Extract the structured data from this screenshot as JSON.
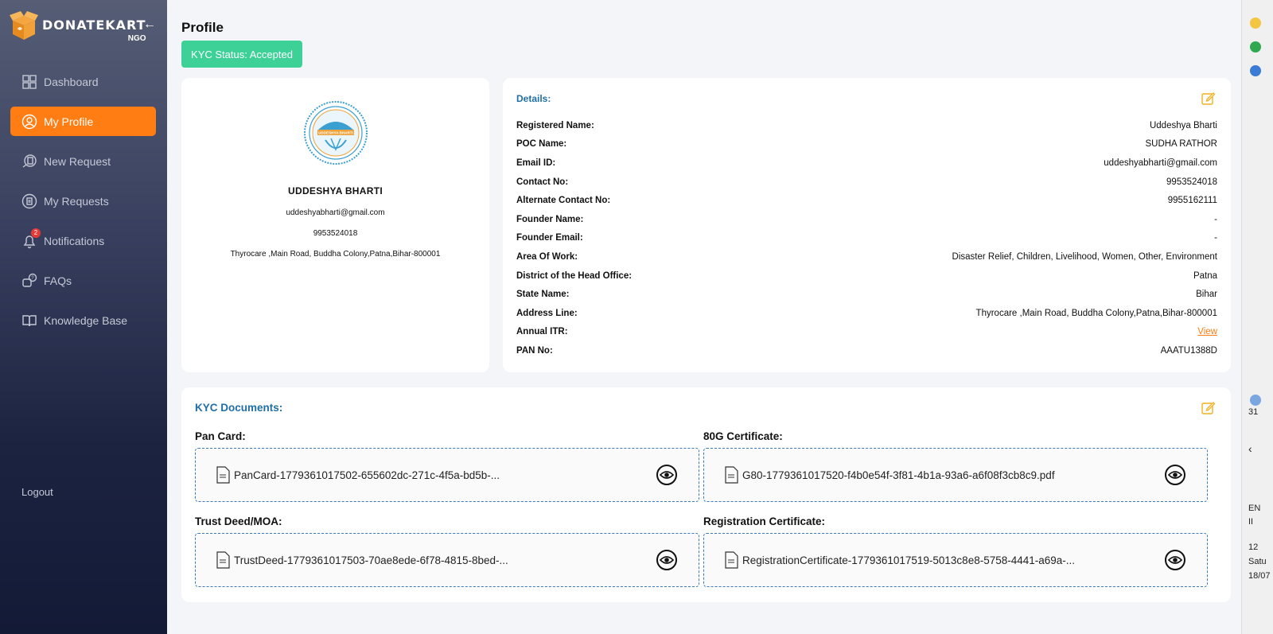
{
  "brand": {
    "name": "DONATEKART",
    "sub": "NGO"
  },
  "sidebar": {
    "items": [
      {
        "label": "Dashboard",
        "icon": "dashboard-icon",
        "active": false
      },
      {
        "label": "My Profile",
        "icon": "user-icon",
        "active": true
      },
      {
        "label": "New Request",
        "icon": "new-request-icon",
        "active": false
      },
      {
        "label": "My Requests",
        "icon": "requests-icon",
        "active": false
      },
      {
        "label": "Notifications",
        "icon": "bell-icon",
        "active": false,
        "badge": "2"
      },
      {
        "label": "FAQs",
        "icon": "faq-icon",
        "active": false
      },
      {
        "label": "Knowledge Base",
        "icon": "book-icon",
        "active": false
      }
    ],
    "logout_label": "Logout"
  },
  "page": {
    "title": "Profile",
    "kyc_status": "KYC Status: Accepted"
  },
  "profile": {
    "name": "UDDESHYA BHARTI",
    "email": "uddeshyabharti@gmail.com",
    "phone": "9953524018",
    "address": "Thyrocare ,Main Road, Buddha Colony,Patna,Bihar-800001",
    "logo_text": "UDDESHYA BHARTI"
  },
  "details": {
    "heading": "Details:",
    "rows": [
      {
        "label": "Registered Name:",
        "value": "Uddeshya Bharti"
      },
      {
        "label": "POC Name:",
        "value": "SUDHA RATHOR"
      },
      {
        "label": "Email ID:",
        "value": "uddeshyabharti@gmail.com"
      },
      {
        "label": "Contact No:",
        "value": "9953524018"
      },
      {
        "label": "Alternate Contact No:",
        "value": "9955162111"
      },
      {
        "label": "Founder Name:",
        "value": "-"
      },
      {
        "label": "Founder Email:",
        "value": "-"
      },
      {
        "label": "Area Of Work:",
        "value": "Disaster Relief, Children, Livelihood, Women, Other, Environment"
      },
      {
        "label": "District of the Head Office:",
        "value": "Patna"
      },
      {
        "label": "State Name:",
        "value": "Bihar"
      },
      {
        "label": "Address Line:",
        "value": "Thyrocare ,Main Road, Buddha Colony,Patna,Bihar-800001"
      },
      {
        "label": "Annual ITR:",
        "value": "View"
      },
      {
        "label": "PAN No:",
        "value": "AAATU1388D"
      }
    ]
  },
  "kyc": {
    "heading": "KYC Documents:",
    "docs": [
      {
        "label": "Pan Card:",
        "file": "PanCard-1779361017502-655602dc-271c-4f5a-bd5b-..."
      },
      {
        "label": "80G Certificate:",
        "file": "G80-1779361017520-f4b0e54f-3f81-4b1a-93a6-a6f08f3cb8c9.pdf"
      },
      {
        "label": "Trust Deed/MOA:",
        "file": "TrustDeed-1779361017503-70ae8ede-6f78-4815-8bed-..."
      },
      {
        "label": "Registration Certificate:",
        "file": "RegistrationCertificate-1779361017519-5013c8e8-5758-4441-a69a-..."
      }
    ]
  },
  "right_strip": {
    "temp": "31",
    "lang1": "EN",
    "lang2": "II",
    "time": "12",
    "day": "Satu",
    "date": "18/07"
  },
  "colors": {
    "accent": "#ff7d12",
    "success": "#3dd198",
    "heading_blue": "#1f6fa5",
    "edit_yellow": "#f2b01e"
  }
}
